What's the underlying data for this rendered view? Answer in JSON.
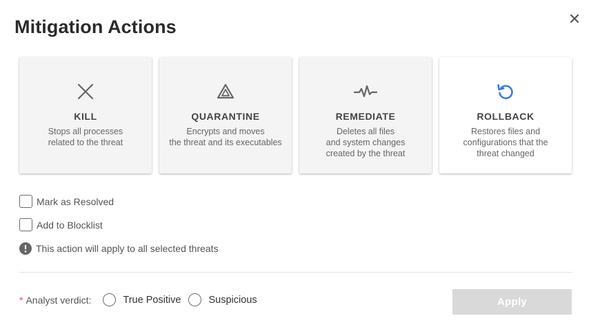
{
  "dialog": {
    "title": "Mitigation Actions",
    "close_icon": "close-icon"
  },
  "actions": [
    {
      "title": "KILL",
      "desc_lines": [
        "Stops all processes",
        "related to the threat"
      ],
      "icon": "x-icon",
      "selected": false
    },
    {
      "title": "QUARANTINE",
      "desc_lines": [
        "Encrypts and moves",
        "the threat and its executables"
      ],
      "icon": "triangle-icon",
      "selected": false
    },
    {
      "title": "REMEDIATE",
      "desc_lines": [
        "Deletes all files",
        "and system changes",
        "created by the threat"
      ],
      "icon": "pulse-icon",
      "selected": false
    },
    {
      "title": "ROLLBACK",
      "desc_lines": [
        "Restores files and",
        "configurations that the",
        "threat changed"
      ],
      "icon": "rollback-icon",
      "selected": true
    }
  ],
  "options": {
    "mark_resolved": "Mark as Resolved",
    "add_blocklist": "Add to Blocklist"
  },
  "info": {
    "text": "This action will apply to all selected threats",
    "icon": "exclamation-circle-icon"
  },
  "verdict": {
    "required_marker": "*",
    "label": "Analyst verdict:",
    "options": [
      "True Positive",
      "Suspicious"
    ]
  },
  "apply_label": "Apply",
  "colors": {
    "accent_blue": "#3b7dd8",
    "icon_gray": "#666666",
    "required_red": "#d9534f",
    "disabled_button": "#d9d9d9"
  }
}
